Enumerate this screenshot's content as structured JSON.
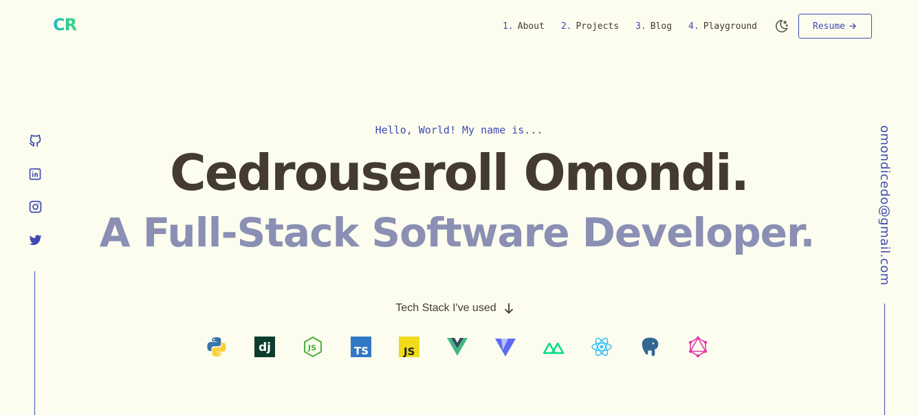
{
  "logo": {
    "text": "CR"
  },
  "nav": {
    "items": [
      {
        "num": "1.",
        "label": "About"
      },
      {
        "num": "2.",
        "label": "Projects"
      },
      {
        "num": "3.",
        "label": "Blog"
      },
      {
        "num": "4.",
        "label": "Playground"
      }
    ],
    "theme_icon": "moon-stars-icon",
    "resume_label": "Resume"
  },
  "socials": [
    "github-icon",
    "linkedin-icon",
    "instagram-icon",
    "twitter-icon"
  ],
  "hero": {
    "greeting": "Hello, World! My name is...",
    "name": "Cedrouseroll Omondi.",
    "tagline": "A Full-Stack Software Developer."
  },
  "email": "omondicedo@gmail.com",
  "stack": {
    "title": "Tech Stack I've used",
    "icons": [
      "python-icon",
      "django-icon",
      "nodejs-icon",
      "typescript-icon",
      "javascript-icon",
      "vue-icon",
      "vite-icon",
      "nuxt-icon",
      "react-icon",
      "postgresql-icon",
      "graphql-icon"
    ]
  },
  "colors": {
    "background": "#fcfdef",
    "accent": "#3f4ab3",
    "text": "#433b2f",
    "muted": "#8a8fb3"
  }
}
